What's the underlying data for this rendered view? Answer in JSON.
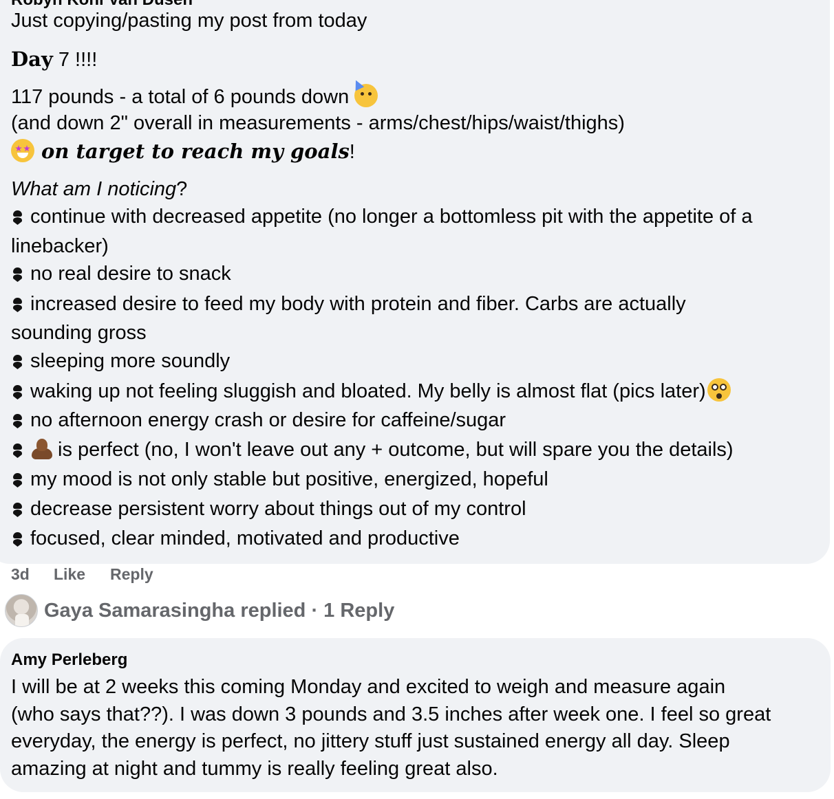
{
  "comment1": {
    "author": "Robyn Kohl Van Dusen",
    "intro": "Just copying/pasting my post from today",
    "day_label": "Day",
    "day_rest": " 7 !!!!",
    "weight_line": "117 pounds - a total of 6 pounds down",
    "measure_line": "(and down 2\" overall in measurements - arms/chest/hips/waist/thighs)",
    "target_text": "on target to reach my goals",
    "target_end": "!",
    "noticing": "What am I noticing",
    "noticing_end": "?",
    "bullets": [
      "continue with decreased appetite (no longer a bottomless pit with the appetite of a",
      "linebacker)",
      "no real desire to snack",
      "increased desire to feed my body with protein and fiber. Carbs are actually",
      "sounding gross",
      "sleeping more soundly",
      "waking up not feeling sluggish and bloated. My belly is almost flat (pics later)",
      "no afternoon energy crash or desire for caffeine/sugar",
      "is perfect (no, I won't leave out any + outcome, but will spare you the details)",
      "my mood is not only stable but positive, energized, hopeful",
      "decrease persistent worry about things out of my control",
      "focused, clear minded, motivated and productive"
    ],
    "time": "3d",
    "like_label": "Like",
    "reply_label": "Reply"
  },
  "replies": {
    "text": "Gaya Samarasingha replied · 1 Reply"
  },
  "comment2": {
    "author": "Amy Perleberg",
    "lines": [
      "I will be at 2 weeks this coming Monday and excited to weigh and measure again",
      "(who says that??). I was down 3 pounds and 3.5 inches after week one. I feel so great",
      "everyday, the energy is perfect, no jittery stuff just sustained energy all day. Sleep",
      "amazing at night and tummy is really feeling great also."
    ]
  },
  "icons": {
    "bullet": "heart-exclamation-icon",
    "party": "partying-face-icon",
    "star": "star-struck-icon",
    "flushed": "flushed-face-icon",
    "poop": "pile-of-poo-icon"
  }
}
